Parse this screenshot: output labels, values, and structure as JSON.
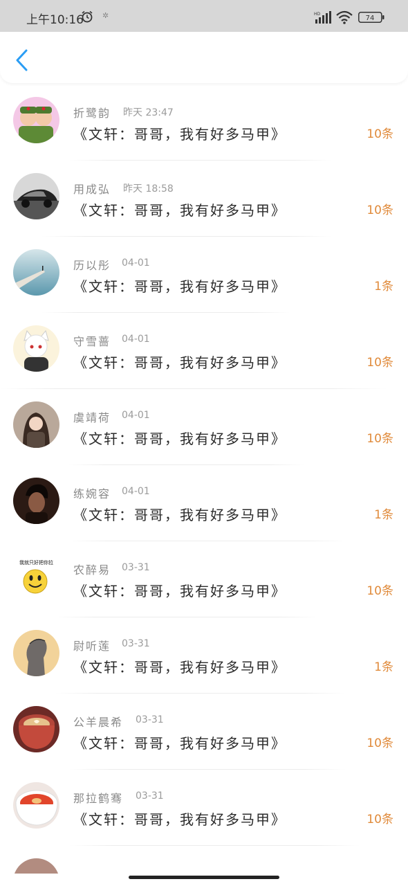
{
  "status_bar": {
    "time": "上午10:16",
    "battery": "74",
    "hd": "HD"
  },
  "colors": {
    "accent_blue": "#2a9df4",
    "count_orange": "#e08a3a"
  },
  "items": [
    {
      "name": "折鹭韵",
      "time": "昨天 23:47",
      "title": "《文轩：哥哥，我有好多马甲》",
      "count": "10条",
      "avatar_icon": "avatar-soldier-cartoon"
    },
    {
      "name": "用成弘",
      "time": "昨天 18:58",
      "title": "《文轩：哥哥，我有好多马甲》",
      "count": "10条",
      "avatar_icon": "avatar-car"
    },
    {
      "name": "历以彤",
      "time": "04-01",
      "title": "《文轩：哥哥，我有好多马甲》",
      "count": "1条",
      "avatar_icon": "avatar-pier"
    },
    {
      "name": "守雪蔷",
      "time": "04-01",
      "title": "《文轩：哥哥，我有好多马甲》",
      "count": "10条",
      "avatar_icon": "avatar-anime-cat"
    },
    {
      "name": "虞靖荷",
      "time": "04-01",
      "title": "《文轩：哥哥，我有好多马甲》",
      "count": "10条",
      "avatar_icon": "avatar-girl"
    },
    {
      "name": "练婉容",
      "time": "04-01",
      "title": "《文轩：哥哥，我有好多马甲》",
      "count": "1条",
      "avatar_icon": "avatar-man"
    },
    {
      "name": "农醉易",
      "time": "03-31",
      "title": "《文轩：哥哥，我有好多马甲》",
      "count": "10条",
      "avatar_icon": "avatar-smiley",
      "avatar_text": "我就只好把你拉"
    },
    {
      "name": "尉听莲",
      "time": "03-31",
      "title": "《文轩：哥哥，我有好多马甲》",
      "count": "1条",
      "avatar_icon": "avatar-sketch"
    },
    {
      "name": "公羊晨希",
      "time": "03-31",
      "title": "《文轩：哥哥，我有好多马甲》",
      "count": "10条",
      "avatar_icon": "avatar-coffee"
    },
    {
      "name": "那拉鹤骞",
      "time": "03-31",
      "title": "《文轩：哥哥，我有好多马甲》",
      "count": "10条",
      "avatar_icon": "avatar-soup"
    }
  ]
}
